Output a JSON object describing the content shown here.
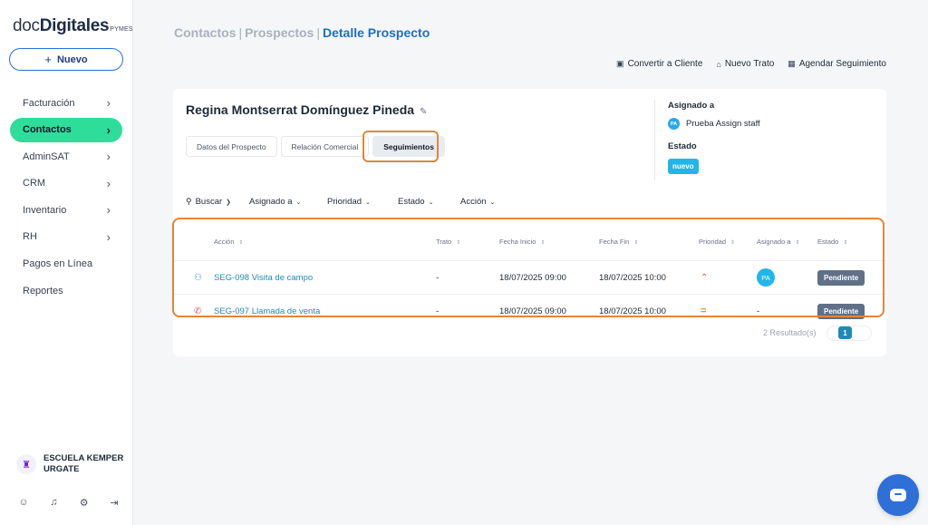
{
  "brand": {
    "part1": "doc",
    "part2": "Digitales",
    "part3": "PYMES"
  },
  "sidebar": {
    "new_button": {
      "icon": "plus-icon",
      "label": "Nuevo"
    },
    "items": [
      {
        "label": "Facturación",
        "chevron": true,
        "active": false
      },
      {
        "label": "Contactos",
        "chevron": true,
        "active": true
      },
      {
        "label": "AdminSAT",
        "chevron": true,
        "active": false
      },
      {
        "label": "CRM",
        "chevron": true,
        "active": false
      },
      {
        "label": "Inventario",
        "chevron": true,
        "active": false
      },
      {
        "label": "RH",
        "chevron": true,
        "active": false
      },
      {
        "label": "Pagos en Línea",
        "chevron": false,
        "active": false
      },
      {
        "label": "Reportes",
        "chevron": false,
        "active": false
      }
    ],
    "organization": {
      "name": "ESCUELA KEMPER URGATE"
    },
    "bottom_icons": [
      "user-icon",
      "bell-icon",
      "gear-icon",
      "logout-icon"
    ]
  },
  "header": {
    "breadcrumb": [
      "Contactos",
      "Prospectos",
      "Detalle Prospecto"
    ],
    "actions": [
      {
        "icon": "convert-icon",
        "label": "Convertir a Cliente"
      },
      {
        "icon": "deal-icon",
        "label": "Nuevo Trato"
      },
      {
        "icon": "calendar-icon",
        "label": "Agendar Seguimiento"
      }
    ]
  },
  "prospect": {
    "name": "Regina Montserrat Domínguez Pineda",
    "tabs": [
      {
        "label": "Datos del Prospecto",
        "active": false
      },
      {
        "label": "Relación Comercial",
        "active": false
      },
      {
        "label": "Seguimientos",
        "active": true
      }
    ],
    "assigned_label": "Asignado a",
    "assigned_initials": "PA",
    "assigned_name": "Prueba Assign staff",
    "status_label": "Estado",
    "status_value": "nuevo"
  },
  "filters": [
    "Buscar",
    "Asignado a",
    "Prioridad",
    "Estado",
    "Acción"
  ],
  "table": {
    "columns": [
      "Acción",
      "Trato",
      "Fecha Inicio",
      "Fecha Fin",
      "Prioridad",
      "Asignado a",
      "Estado"
    ],
    "rows": [
      {
        "icon": "group-icon",
        "accion": "SEG-098 Visita de campo",
        "trato": "-",
        "fecha_inicio": "18/07/2025 09:00",
        "fecha_fin": "18/07/2025 10:00",
        "prioridad": "high",
        "asignado": "PA",
        "estado": "Pendiente"
      },
      {
        "icon": "phone-icon",
        "accion": "SEG-097 Llamada de venta",
        "trato": "-",
        "fecha_inicio": "18/07/2025 09:00",
        "fecha_fin": "18/07/2025 10:00",
        "prioridad": "medium",
        "asignado": "-",
        "estado": "Pendiente"
      }
    ]
  },
  "pagination": {
    "results_text": "2 Resultado(s)",
    "current_page": "1"
  },
  "colors": {
    "accent": "#2fdd9a",
    "primary": "#1f6fc5",
    "highlight": "#e0863b",
    "status_badge": "#5f7087"
  }
}
